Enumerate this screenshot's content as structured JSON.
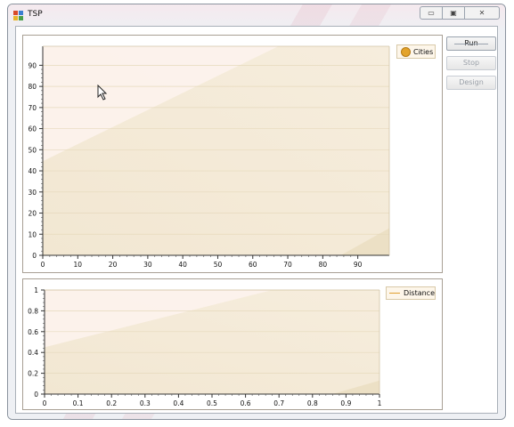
{
  "window": {
    "title": "TSP"
  },
  "caption_buttons": {
    "minimize": "▭",
    "maximize": "▣",
    "close": "✕"
  },
  "sidebar_buttons": [
    {
      "label": "Run",
      "enabled": true
    },
    {
      "label": "Stop",
      "enabled": false
    },
    {
      "label": "Design",
      "enabled": false
    }
  ],
  "chart_data": [
    {
      "type": "scatter",
      "title": "",
      "xlabel": "",
      "ylabel": "",
      "x_ticks": [
        "0",
        "10",
        "20",
        "30",
        "40",
        "50",
        "60",
        "70",
        "80",
        "90"
      ],
      "y_ticks": [
        "0",
        "10",
        "20",
        "30",
        "40",
        "50",
        "60",
        "70",
        "80",
        "90"
      ],
      "xlim": [
        0,
        99
      ],
      "ylim": [
        0,
        99
      ],
      "series": [
        {
          "name": "Cities",
          "points": []
        }
      ],
      "legend": "top-right",
      "grid": true
    },
    {
      "type": "line",
      "title": "",
      "xlabel": "",
      "ylabel": "",
      "x_ticks": [
        "0",
        "0.1",
        "0.2",
        "0.3",
        "0.4",
        "0.5",
        "0.6",
        "0.7",
        "0.8",
        "0.9",
        "1"
      ],
      "y_ticks": [
        "0",
        "0.2",
        "0.4",
        "0.6",
        "0.8",
        "1"
      ],
      "xlim": [
        0,
        1
      ],
      "ylim": [
        0,
        1
      ],
      "series": [
        {
          "name": "Distance",
          "values": []
        }
      ],
      "legend": "top-right",
      "grid": true
    }
  ]
}
